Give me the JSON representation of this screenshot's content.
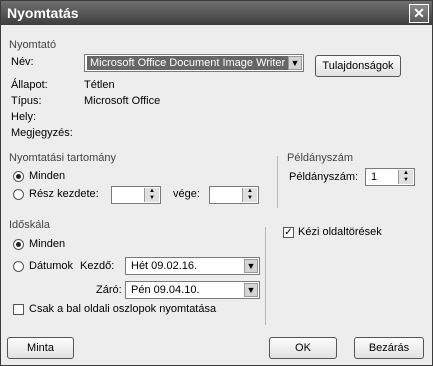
{
  "window": {
    "title": "Nyomtatás"
  },
  "printer": {
    "section": "Nyomtató",
    "name_label": "Név:",
    "name_value": "Microsoft Office Document Image Writer",
    "properties_button": "Tulajdonságok",
    "status_label": "Állapot:",
    "status_value": "Tétlen",
    "type_label": "Típus:",
    "type_value": "Microsoft Office",
    "location_label": "Hely:",
    "comment_label": "Megjegyzés:"
  },
  "range": {
    "section": "Nyomtatási tartomány",
    "all_label": "Minden",
    "part_label": "Rész kezdete:",
    "end_label": "vége:",
    "start_value": "",
    "end_value": ""
  },
  "copies": {
    "section": "Példányszám",
    "label": "Példányszám:",
    "value": "1"
  },
  "timescale": {
    "section": "Időskála",
    "all_label": "Minden",
    "dates_label": "Dátumok",
    "start_label": "Kezdő:",
    "start_value": "Hét 09.02.16.",
    "end_label": "Záró:",
    "end_value": "Pén 09.04.10.",
    "left_columns_label": "Csak a bal oldali oszlopok nyomtatása"
  },
  "manual_page_breaks": {
    "label": "Kézi oldaltörések",
    "checked": true
  },
  "buttons": {
    "preview": "Minta",
    "ok": "OK",
    "close": "Bezárás"
  }
}
